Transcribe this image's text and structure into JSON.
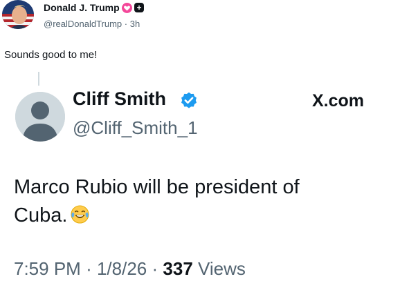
{
  "post": {
    "author_name": "Donald J. Trump",
    "handle": "@realDonaldTrump",
    "separator": "·",
    "age": "3h",
    "text": "Sounds good to me!",
    "badges": [
      "heart-badge",
      "plus-badge"
    ]
  },
  "quoted": {
    "author_name": "Cliff Smith",
    "handle": "@Cliff_Smith_1",
    "site_logo": "X.com",
    "body_line1": "Marco Rubio will be president of",
    "body_line2": "Cuba.",
    "emoji": "face-with-tears-of-joy",
    "time": "7:59 PM",
    "sep1": "·",
    "date": "1/8/26",
    "sep2": "·",
    "views_count": "337",
    "views_label": "Views"
  },
  "colors": {
    "text": "#0f1419",
    "secondary": "#536471",
    "verified": "#1d9bf0",
    "heart_badge": "#f4489a",
    "avatar_placeholder": "#cfd9de"
  }
}
